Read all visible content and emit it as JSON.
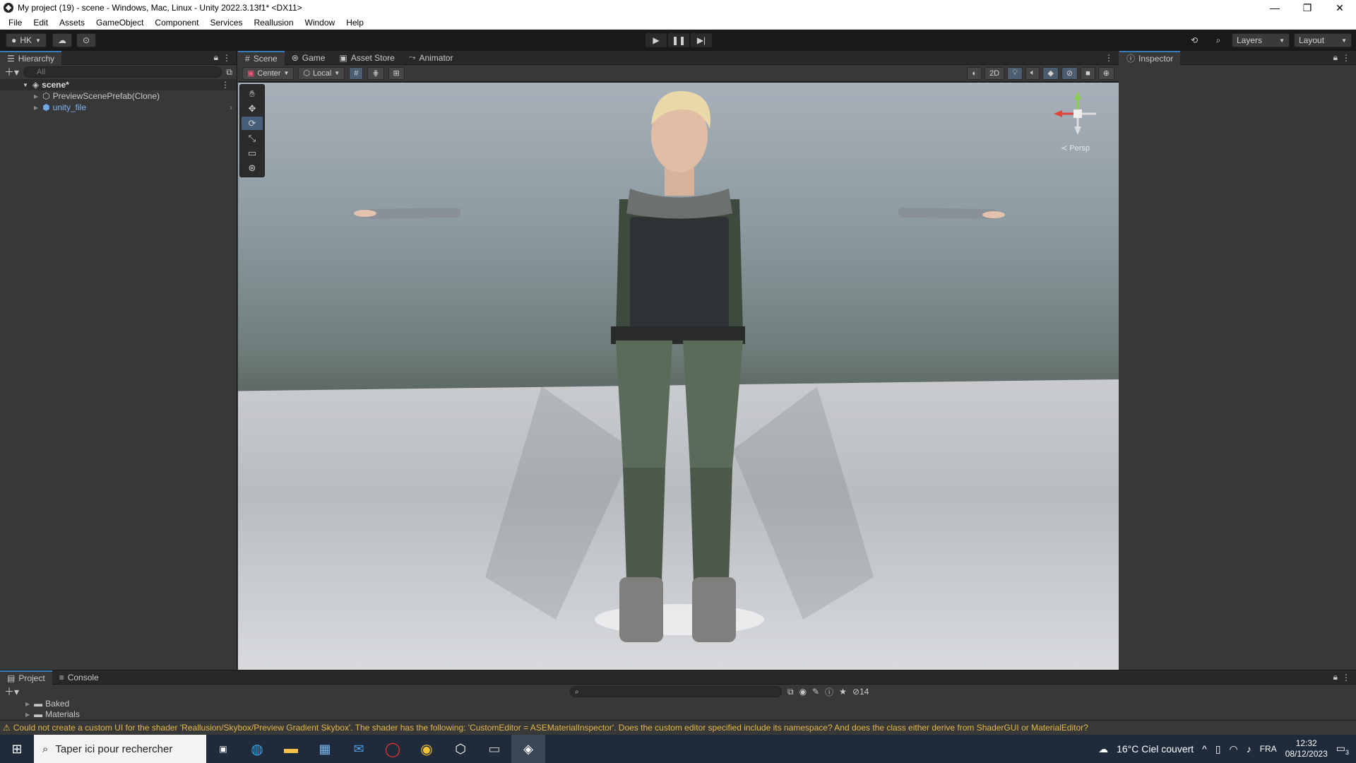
{
  "window": {
    "title": "My project (19) - scene - Windows, Mac, Linux - Unity 2022.3.13f1* <DX11>",
    "controls": [
      "—",
      "❐",
      "✕"
    ]
  },
  "menu": [
    "File",
    "Edit",
    "Assets",
    "GameObject",
    "Component",
    "Services",
    "Reallusion",
    "Window",
    "Help"
  ],
  "toolbar": {
    "account": "HK",
    "layers": "Layers",
    "layout": "Layout"
  },
  "hierarchy": {
    "tab": "Hierarchy",
    "search_placeholder": "All",
    "scene": "scene*",
    "items": [
      "PreviewScenePrefab(Clone)",
      "unity_file"
    ]
  },
  "scene_tabs": [
    "Scene",
    "Game",
    "Asset Store",
    "Animator"
  ],
  "scene_toolbar": {
    "pivot": "Center",
    "space": "Local",
    "mode_2d": "2D"
  },
  "gizmo": {
    "label": "Persp"
  },
  "inspector": {
    "tab": "Inspector"
  },
  "bottom": {
    "tabs": [
      "Project",
      "Console"
    ],
    "tree": [
      "Baked",
      "Materials"
    ],
    "hidden_count": "14"
  },
  "status": {
    "message": "Could not create a custom UI for the shader 'Reallusion/Skybox/Preview Gradient Skybox'. The shader has the following: 'CustomEditor = ASEMaterialInspector'. Does the custom editor specified include its namespace? And does the class either derive from ShaderGUI or MaterialEditor?"
  },
  "taskbar": {
    "search": "Taper ici pour rechercher",
    "weather": "16°C  Ciel couvert",
    "lang": "FRA",
    "time": "12:32",
    "date": "08/12/2023",
    "notif": "3"
  },
  "colors": {
    "accent": "#3a79bb",
    "warning": "#e3b84a",
    "editor_bg": "#383838"
  }
}
